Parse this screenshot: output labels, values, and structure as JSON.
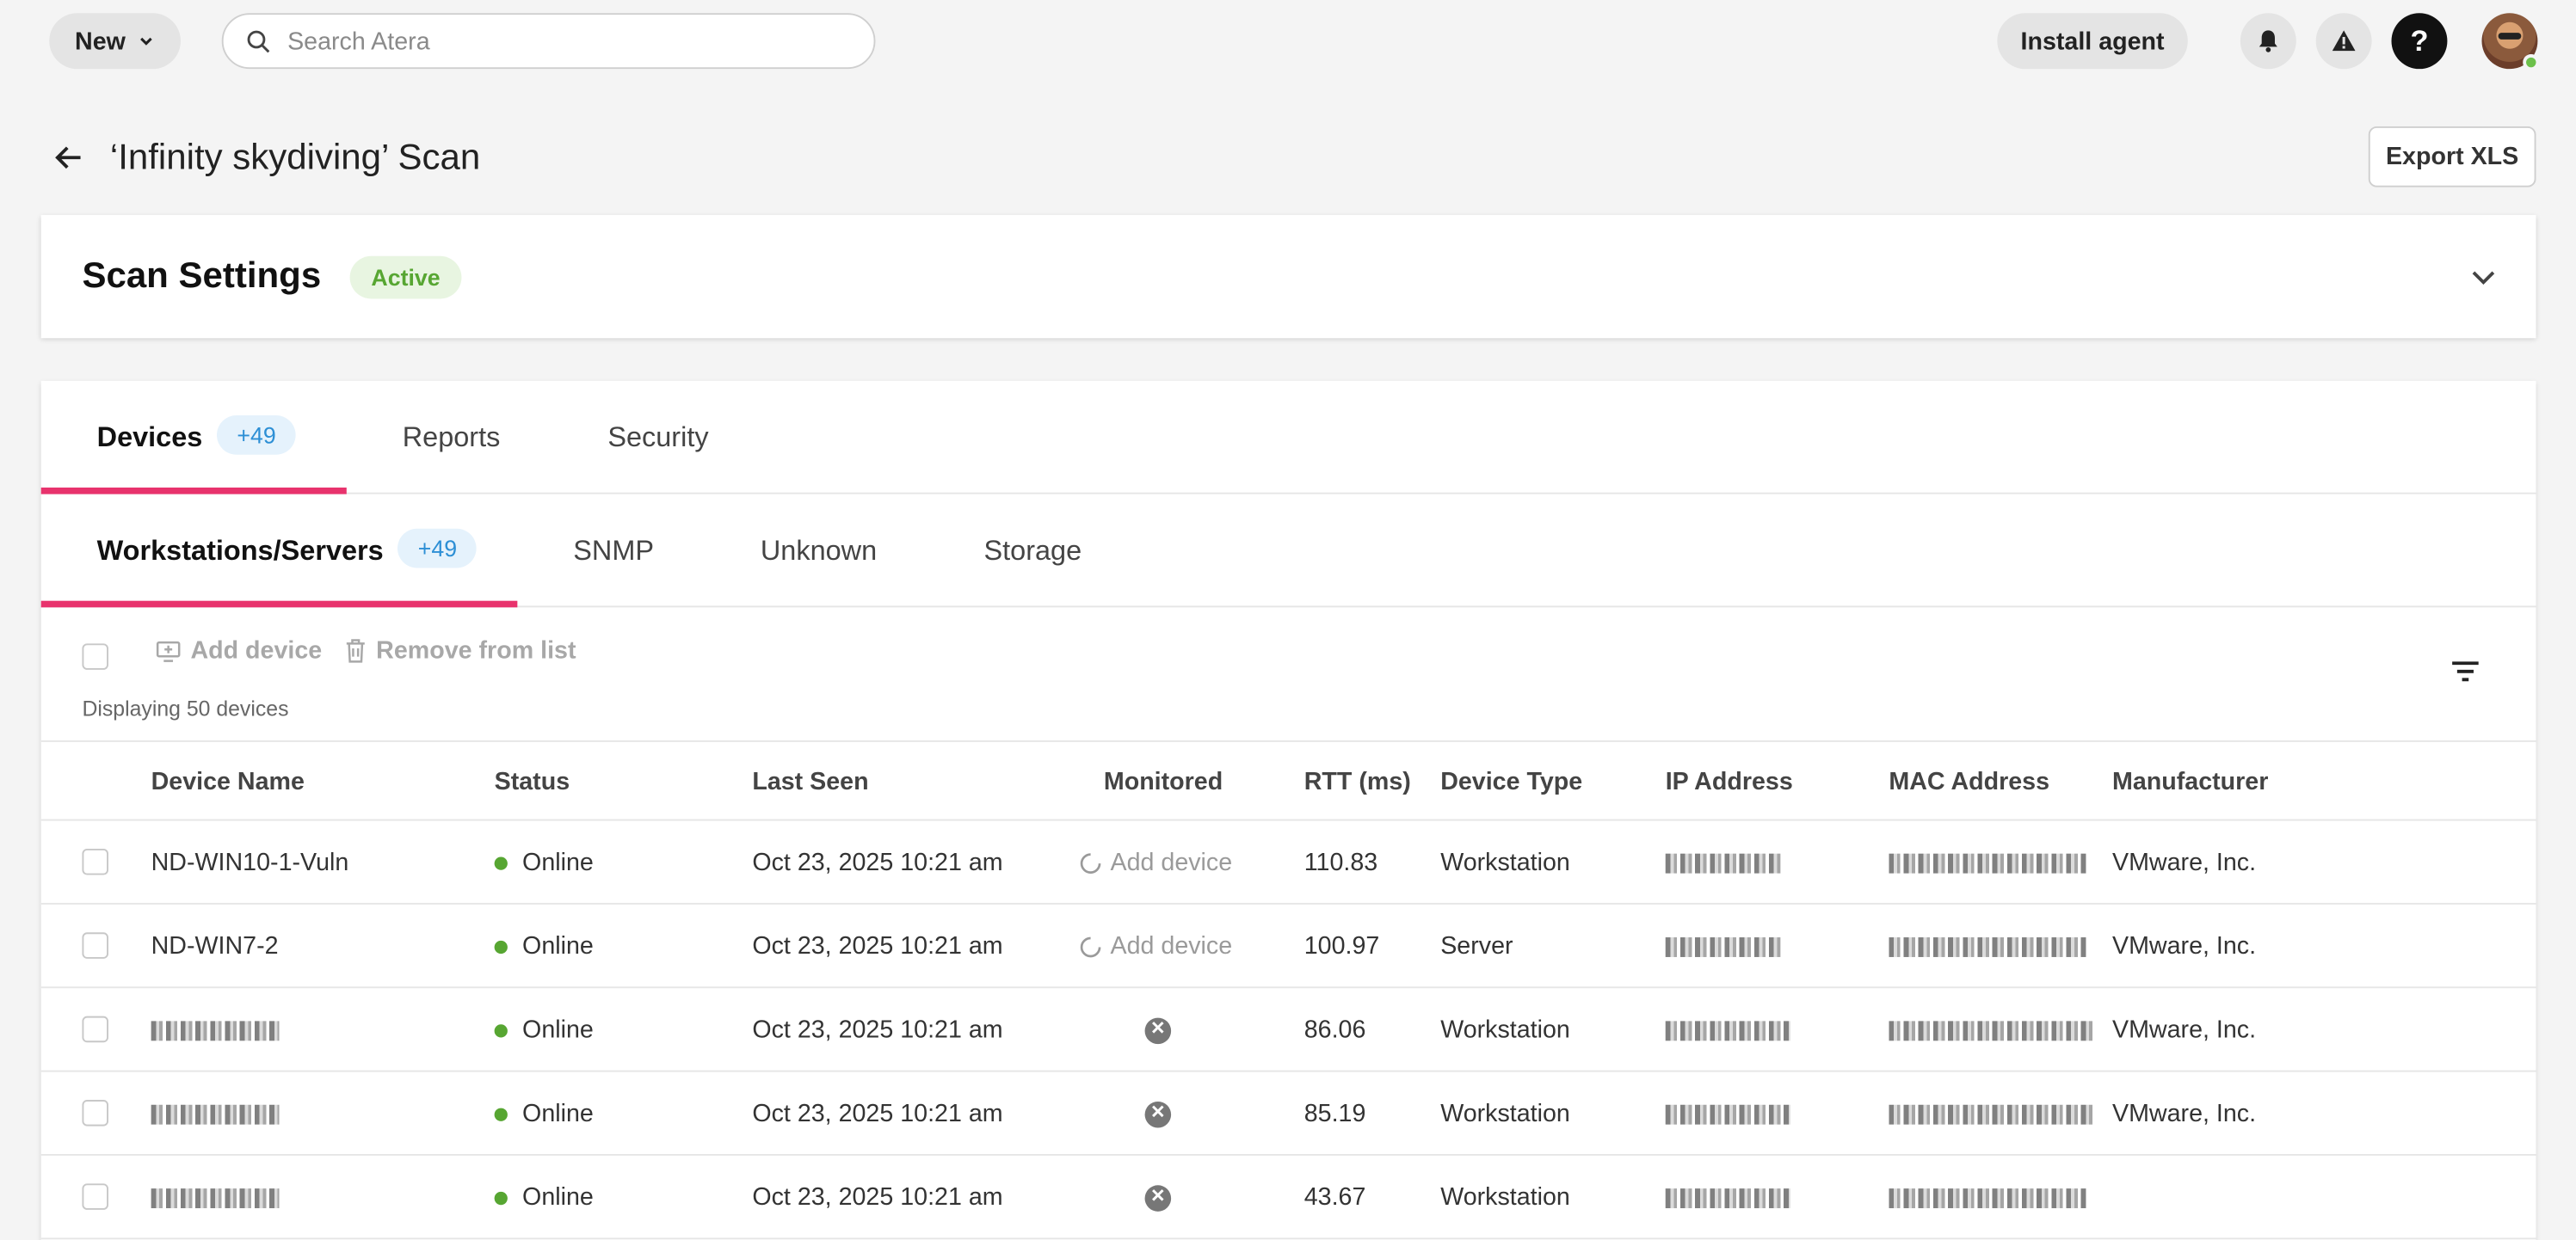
{
  "topbar": {
    "new_label": "New",
    "search_placeholder": "Search Atera",
    "install_label": "Install agent",
    "help_label": "?"
  },
  "page": {
    "title": "‘Infinity skydiving’ Scan",
    "export_label": "Export XLS"
  },
  "scan_settings": {
    "title": "Scan Settings",
    "status": "Active"
  },
  "tabs": [
    {
      "label": "Devices",
      "count": "+49"
    },
    {
      "label": "Reports"
    },
    {
      "label": "Security"
    }
  ],
  "subtabs": [
    {
      "label": "Workstations/Servers",
      "count": "+49"
    },
    {
      "label": "SNMP"
    },
    {
      "label": "Unknown"
    },
    {
      "label": "Storage"
    }
  ],
  "toolbar": {
    "add_device": "Add device",
    "remove": "Remove from list",
    "displaying": "Displaying 50 devices"
  },
  "columns": [
    "Device Name",
    "Status",
    "Last Seen",
    "Monitored",
    "RTT (ms)",
    "Device Type",
    "IP Address",
    "MAC Address",
    "Manufacturer"
  ],
  "rows": [
    {
      "name": "ND-WIN10-1-Vuln",
      "status": "Online",
      "last_seen": "Oct 23, 2025 10:21 am",
      "monitored": "Add device",
      "rtt": "110.83",
      "type": "Workstation",
      "manufacturer": "VMware, Inc."
    },
    {
      "name": "ND-WIN7-2",
      "status": "Online",
      "last_seen": "Oct 23, 2025 10:21 am",
      "monitored": "Add device",
      "rtt": "100.97",
      "type": "Server",
      "manufacturer": "VMware, Inc."
    },
    {
      "name": "",
      "status": "Online",
      "last_seen": "Oct 23, 2025 10:21 am",
      "monitored": "",
      "rtt": "86.06",
      "type": "Workstation",
      "manufacturer": "VMware, Inc."
    },
    {
      "name": "",
      "status": "Online",
      "last_seen": "Oct 23, 2025 10:21 am",
      "monitored": "",
      "rtt": "85.19",
      "type": "Workstation",
      "manufacturer": "VMware, Inc."
    },
    {
      "name": "",
      "status": "Online",
      "last_seen": "Oct 23, 2025 10:21 am",
      "monitored": "",
      "rtt": "43.67",
      "type": "Workstation",
      "manufacturer": ""
    }
  ],
  "colors": {
    "accent": "#e8336d",
    "badge_blue": "#2d8fd5",
    "online": "#57a632"
  }
}
